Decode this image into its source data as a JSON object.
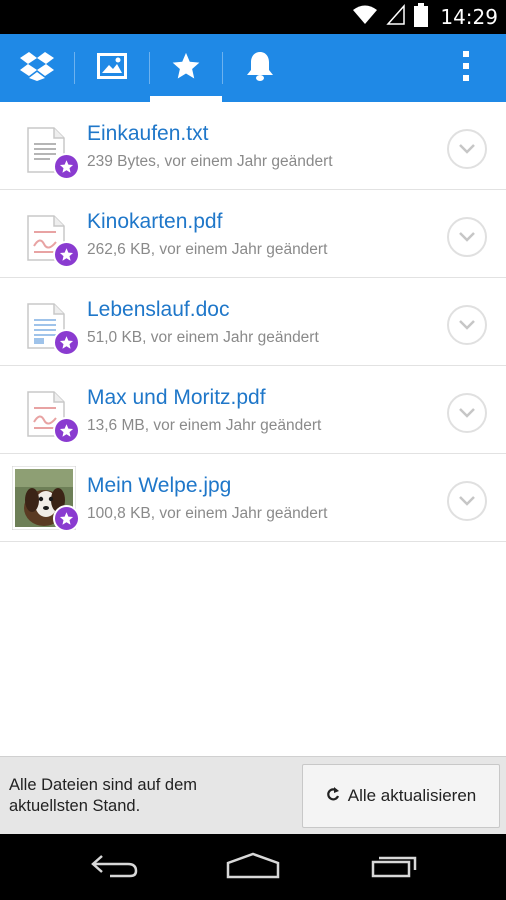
{
  "status_bar": {
    "time": "14:29",
    "icons": [
      "wifi-icon",
      "signal-icon",
      "battery-icon"
    ]
  },
  "app_bar": {
    "tabs": [
      {
        "name": "dropbox-icon",
        "active": false
      },
      {
        "name": "photos-icon",
        "active": false
      },
      {
        "name": "favorites-star-icon",
        "active": true
      },
      {
        "name": "notifications-bell-icon",
        "active": false
      }
    ],
    "overflow_icon": "more-vertical-icon",
    "color": "#1f89e6"
  },
  "files": [
    {
      "name": "Einkaufen.txt",
      "meta": "239 Bytes, vor einem Jahr geändert",
      "type": "txt",
      "favorite": true
    },
    {
      "name": "Kinokarten.pdf",
      "meta": "262,6 KB, vor einem Jahr geändert",
      "type": "pdf",
      "favorite": true
    },
    {
      "name": "Lebenslauf.doc",
      "meta": "51,0 KB, vor einem Jahr geändert",
      "type": "doc",
      "favorite": true
    },
    {
      "name": "Max und Moritz.pdf",
      "meta": "13,6 MB, vor einem Jahr geändert",
      "type": "pdf",
      "favorite": true
    },
    {
      "name": "Mein Welpe.jpg",
      "meta": "100,8 KB, vor einem Jahr geändert",
      "type": "jpg",
      "favorite": true
    }
  ],
  "footer": {
    "status_text": "Alle Dateien sind auf dem aktuellsten Stand.",
    "refresh_label": "Alle aktualisieren"
  },
  "nav_bar": {
    "buttons": [
      "back-icon",
      "home-icon",
      "recents-icon"
    ]
  },
  "colors": {
    "accent": "#1f89e6",
    "link": "#1f77c9",
    "favorite_badge": "#8a3bd0"
  }
}
